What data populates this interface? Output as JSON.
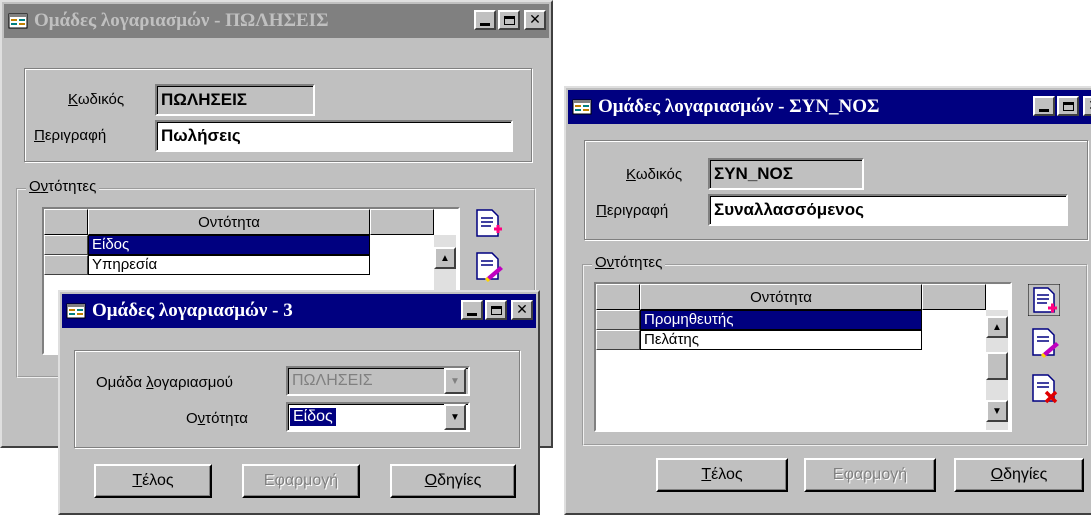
{
  "win1": {
    "title": "Ομάδες λογαριασμών - ΠΩΛΗΣΕΙΣ",
    "code_label_ul": "Κ",
    "code_label_rest": "ωδικός",
    "code_value": "ΠΩΛΗΣΕΙΣ",
    "desc_label_ul": "Π",
    "desc_label_rest": "εριγραφή",
    "desc_value": "Πωλήσεις",
    "group_ul1": "Ο",
    "group_ul2": "ν",
    "group_rest": "τότητες",
    "col_header": "Οντότητα",
    "rows": [
      "Είδος",
      "Υπηρεσία"
    ]
  },
  "win3": {
    "title": "Ομάδες λογαριασμών - 3",
    "group_label_a": "Ομάδα ",
    "group_label_ul": "λ",
    "group_label_b": "ογαριασμού",
    "group_value": "ΠΩΛΗΣΕΙΣ",
    "entity_label_a": "Ο",
    "entity_label_ul": "ν",
    "entity_label_b": "τότητα",
    "entity_value": "Είδος",
    "btn_end_ul": "Τ",
    "btn_end_rest": "έλος",
    "btn_apply": "Εφαρμογή",
    "btn_help_ul": "Ο",
    "btn_help_rest": "δηγίες"
  },
  "win2": {
    "title": "Ομάδες λογαριασμών - ΣΥΝ_ΝΟΣ",
    "code_label_ul": "Κ",
    "code_label_rest": "ωδικός",
    "code_value": "ΣΥΝ_ΝΟΣ",
    "desc_label_ul": "Π",
    "desc_label_rest": "εριγραφή",
    "desc_value": "Συναλλασσόμενος",
    "group_ul1": "Ο",
    "group_ul2": "ν",
    "group_rest": "τότητες",
    "col_header": "Οντότητα",
    "rows": [
      "Προμηθευτής",
      "Πελάτης"
    ],
    "btn_end_ul": "Τ",
    "btn_end_rest": "έλος",
    "btn_apply": "Εφαρμογή",
    "btn_help_ul": "Ο",
    "btn_help_rest": "δηγίες"
  },
  "icons": [
    "app-icon",
    "minimize-icon",
    "maximize-icon",
    "close-icon",
    "add-record-icon",
    "edit-record-icon",
    "delete-record-icon",
    "scroll-up-icon",
    "scroll-down-icon",
    "dropdown-arrow-icon"
  ],
  "colors": {
    "titlebar_active": "#000080",
    "titlebar_inactive": "#808080",
    "face": "#c0c0c0",
    "selection": "#000080"
  }
}
